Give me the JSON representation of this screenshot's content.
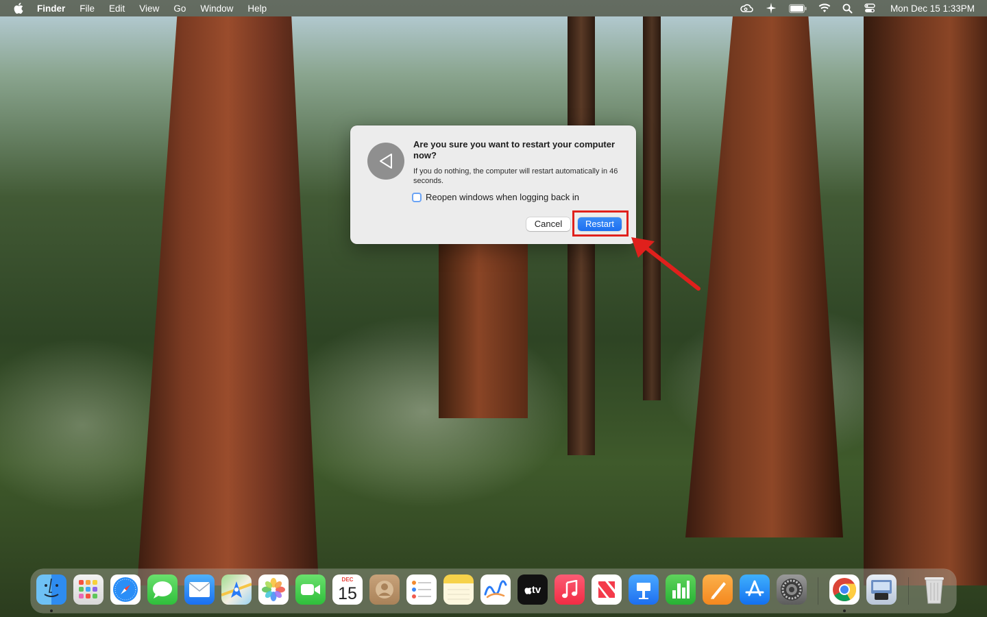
{
  "menubar": {
    "app_name": "Finder",
    "menus": [
      "File",
      "Edit",
      "View",
      "Go",
      "Window",
      "Help"
    ],
    "clock": "Mon Dec 15  1:33PM",
    "status_icons": [
      "creative-cloud-icon",
      "airplane-icon",
      "battery-icon",
      "wifi-icon",
      "spotlight-search-icon",
      "control-center-icon"
    ]
  },
  "dialog": {
    "title": "Are you sure you want to restart your computer now?",
    "message": "If you do nothing, the computer will restart automatically in 46 seconds.",
    "checkbox_label": "Reopen windows when logging back in",
    "checkbox_checked": false,
    "cancel_label": "Cancel",
    "restart_label": "Restart"
  },
  "annotation_color": "#e0201c",
  "dock": {
    "apps": [
      "Finder",
      "Launchpad",
      "Safari",
      "Messages",
      "Mail",
      "Maps",
      "Photos",
      "FaceTime",
      "Calendar",
      "Contacts",
      "Reminders",
      "Notes",
      "Freeform",
      "TV",
      "Music",
      "News",
      "Keynote",
      "Numbers",
      "Pages",
      "App Store",
      "System Settings",
      "Google Chrome",
      "Preview",
      "Trash"
    ],
    "calendar": {
      "month": "DEC",
      "day": "15"
    },
    "tv_label": "tv"
  }
}
